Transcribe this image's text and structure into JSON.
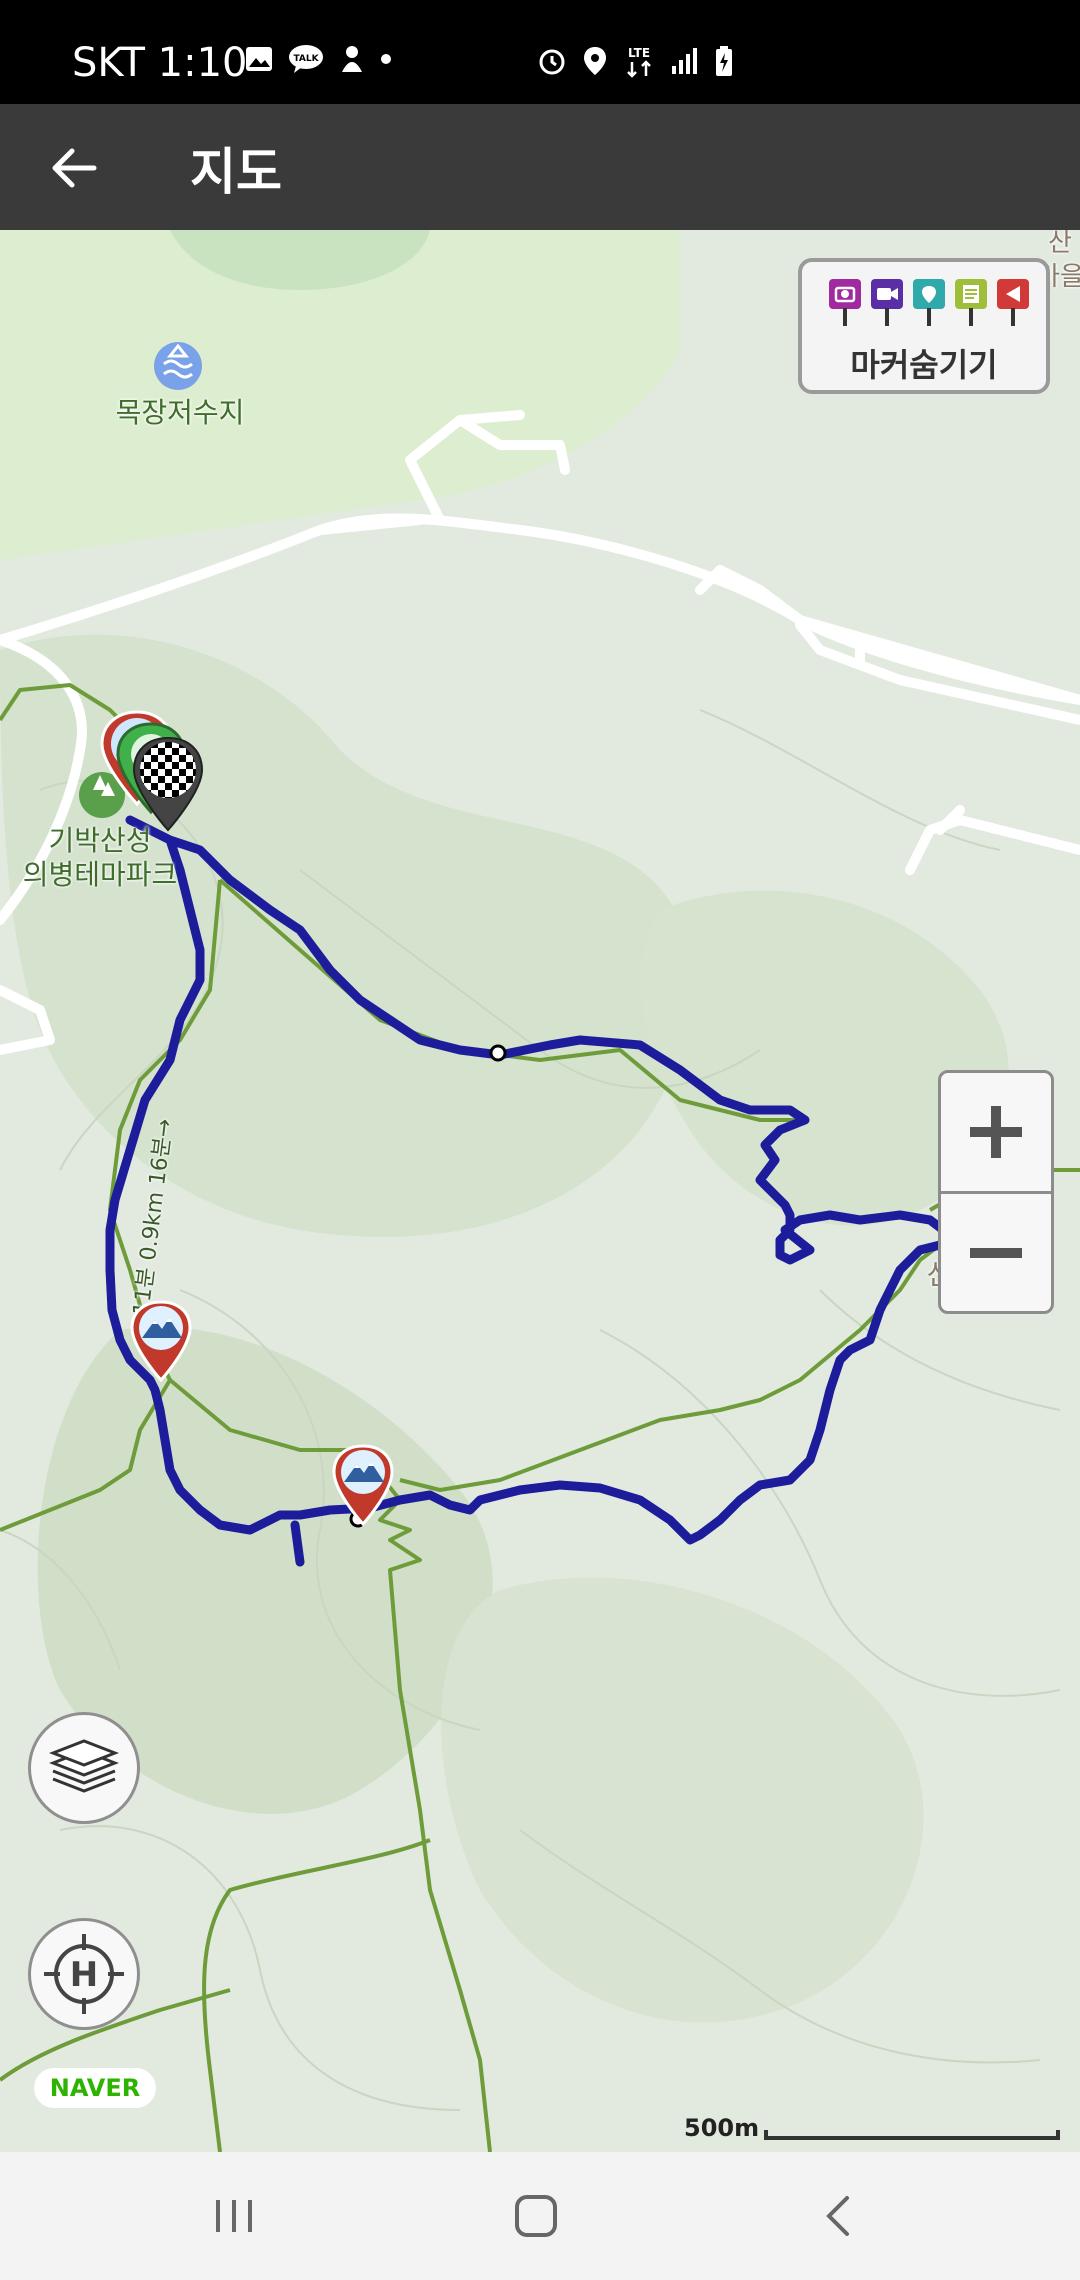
{
  "status_bar": {
    "carrier_time": "SKT 1:10",
    "network": "LTE"
  },
  "app_bar": {
    "title": "지도"
  },
  "map": {
    "marker_toggle": {
      "label": "마커숨기기",
      "pin_colors": [
        "#a02aa0",
        "#5a2fa6",
        "#2fa9a9",
        "#9fbf3a",
        "#d23a3a"
      ]
    },
    "places": {
      "reservoir": "목장저수지",
      "park": "기박산성\n의병테마파크",
      "temple": "신흥사",
      "edge_label": "산\n마을"
    },
    "segment_label": "←11분 0.9km 16분→",
    "route_color": "#1d1d9c",
    "trail_color": "#6e9c3a",
    "scale_label": "500m",
    "provider": "NAVER",
    "zoom": {
      "in": "+",
      "out": "−"
    }
  },
  "nav_bar": {
    "recent": "recent-apps",
    "home": "home",
    "back": "back"
  }
}
